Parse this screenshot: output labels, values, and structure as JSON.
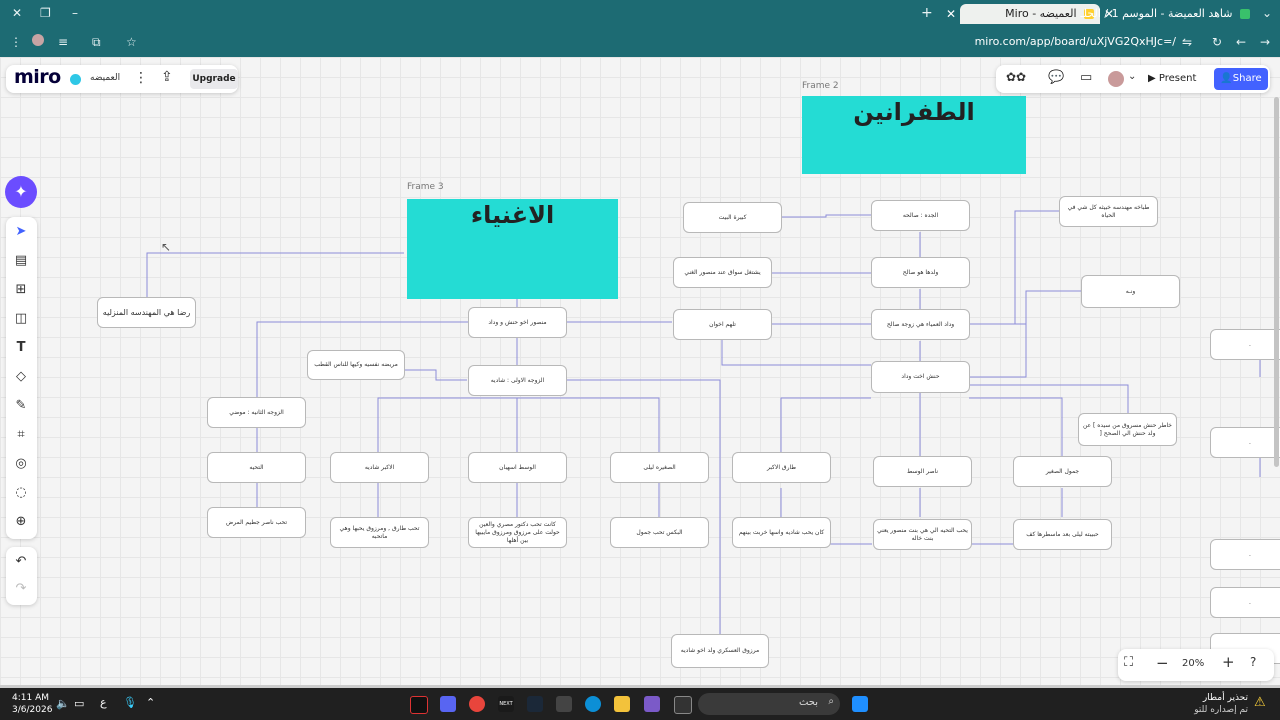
{
  "browser": {
    "tabs": [
      {
        "label": "شاهد العميضة - الموسم 1 / الحلـ",
        "active": false
      },
      {
        "label": "العميضه - Miro",
        "active": true
      }
    ],
    "url": "miro.com/app/board/uXjVG2QxHJc=/"
  },
  "miro": {
    "logo": "miro",
    "board_name": "العميضه",
    "upgrade_label": "Upgrade",
    "present_label": "Present",
    "share_label": "Share",
    "zoom": "20%"
  },
  "frames": {
    "frame2_label": "Frame 2",
    "frame2_title": "الطفرانين",
    "frame3_label": "Frame 3",
    "frame3_title": "الاغنياء"
  },
  "nodes": {
    "reda": "رضا هي المهندسه المنزليه",
    "mansour": "منصور اخو حنش و وداد",
    "zawja_ula": "الزوجه الاولى : شاديه",
    "mariDa": "مريضه نفسيه وكيها للناس القطب",
    "zawja_thania": "الزوجه الثانيه : موضي",
    "tawheed": "التحيه",
    "tawheed_text": "تحب ناصر جطيم المرض",
    "akbar_shadia": "الاكبر شاديه",
    "akbar_shadia_text": "تحب طارق , ومرزوق يحبها وهي ماتحبه",
    "wasat_suhaiban": "الوسط اسهبان",
    "wasat_text": "كانت تحب دكتور مصري والعين حولت على مرزوق ومرزوق مايبيها بين أهلها",
    "sughra_laila": "الصغيره ليلى",
    "laila_text": "البكس تحب جمول",
    "marzouq": "مرزوق العسكري ولد اخو شاديه",
    "jadda": "الجده : صالحه",
    "kabira": "كبيرة البيت",
    "walad": "ولدها هو صالح",
    "yashtaghil": "يشتغل سواق عند منصور الغني",
    "widad": "وداد العمياء هي زوجة صالح",
    "nasr": "تلهم اخوان",
    "hanash": "حنش اخت وداد",
    "tabakha": "طباخه مهندسه خبيثه كل شي في الحياه",
    "radha": "ونـه",
    "khatir": "خاطر حنش مسروق من سيده ] عن ولد حنش الي الصحح [",
    "tariq": "طارق الاكبر",
    "tariq_text": "كان يحب شاديه واسها خربت بينهم",
    "nasser_wasat": "ناصر الوسط",
    "nasser_text": "يحب التحيه الي هي بنت منصور يعني بنت خاله",
    "jamoul": "جمول الصغير",
    "jamoul_text": "حبيبته ليلى بعد ماسطرها كف",
    "side_dot": "."
  },
  "taskbar": {
    "time": "4:11 AM",
    "date": "3/6/2026",
    "lang": "ع",
    "search": "بحث",
    "warning_title": "تحذير أمطار",
    "warning_sub": "تم إصداره للتو"
  },
  "colors": {
    "browser_bar": "#1d6b73",
    "frame_fill": "#24dcd4",
    "share_button": "#4262ff"
  }
}
